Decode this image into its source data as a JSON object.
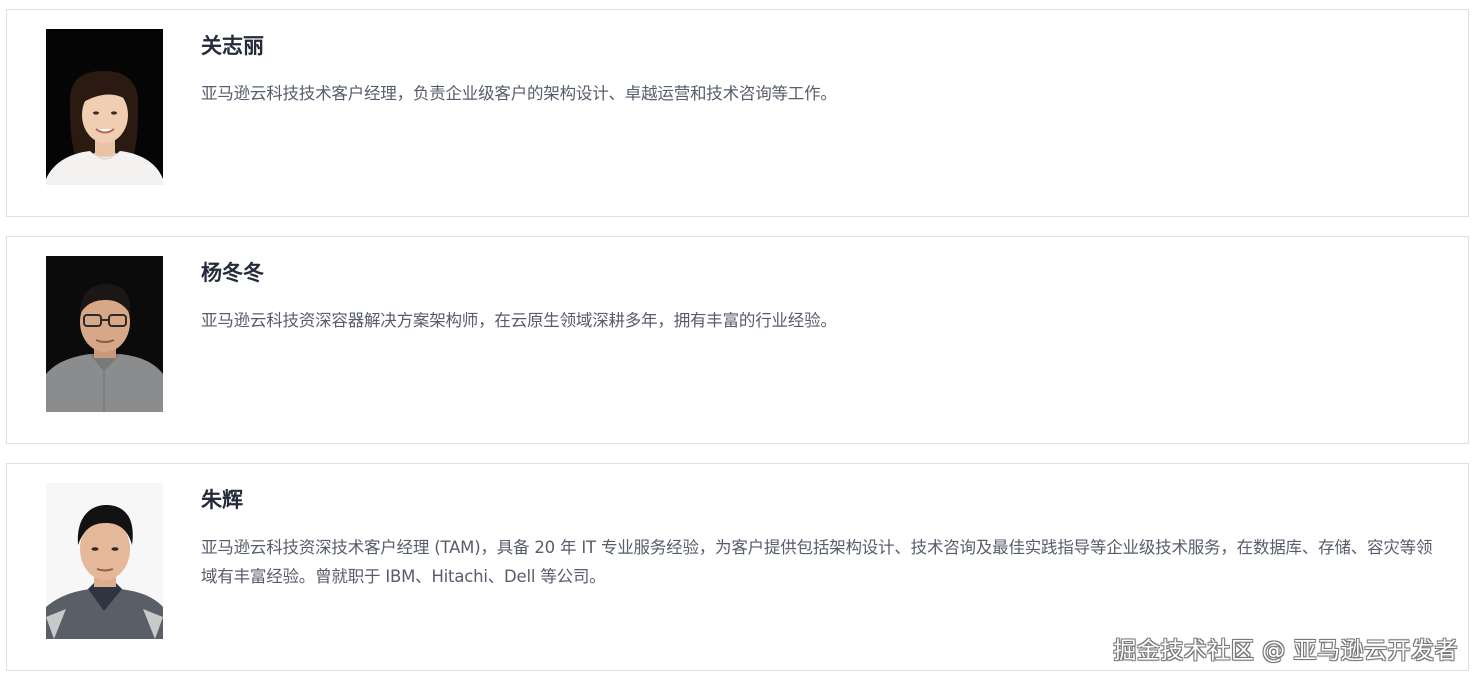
{
  "speakers": [
    {
      "name": "关志丽",
      "bio": "亚马逊云科技技术客户经理，负责企业级客户的架构设计、卓越运营和技术咨询等工作。",
      "photo_icon": "portrait-photo"
    },
    {
      "name": "杨冬冬",
      "bio": "亚马逊云科技资深容器解决方案架构师，在云原生领域深耕多年，拥有丰富的行业经验。",
      "photo_icon": "portrait-photo"
    },
    {
      "name": "朱辉",
      "bio": "亚马逊云科技资深技术客户经理 (TAM)，具备 20 年 IT 专业服务经验，为客户提供包括架构设计、技术咨询及最佳实践指导等企业级技术服务，在数据库、存储、容灾等领域有丰富经验。曾就职于 IBM、Hitachi、Dell 等公司。",
      "photo_icon": "portrait-photo"
    }
  ],
  "watermark": "掘金技术社区 @ 亚马逊云开发者",
  "colors": {
    "card_border": "#dcdfe3",
    "name_text": "#252b3a",
    "bio_text": "#575d6c"
  }
}
